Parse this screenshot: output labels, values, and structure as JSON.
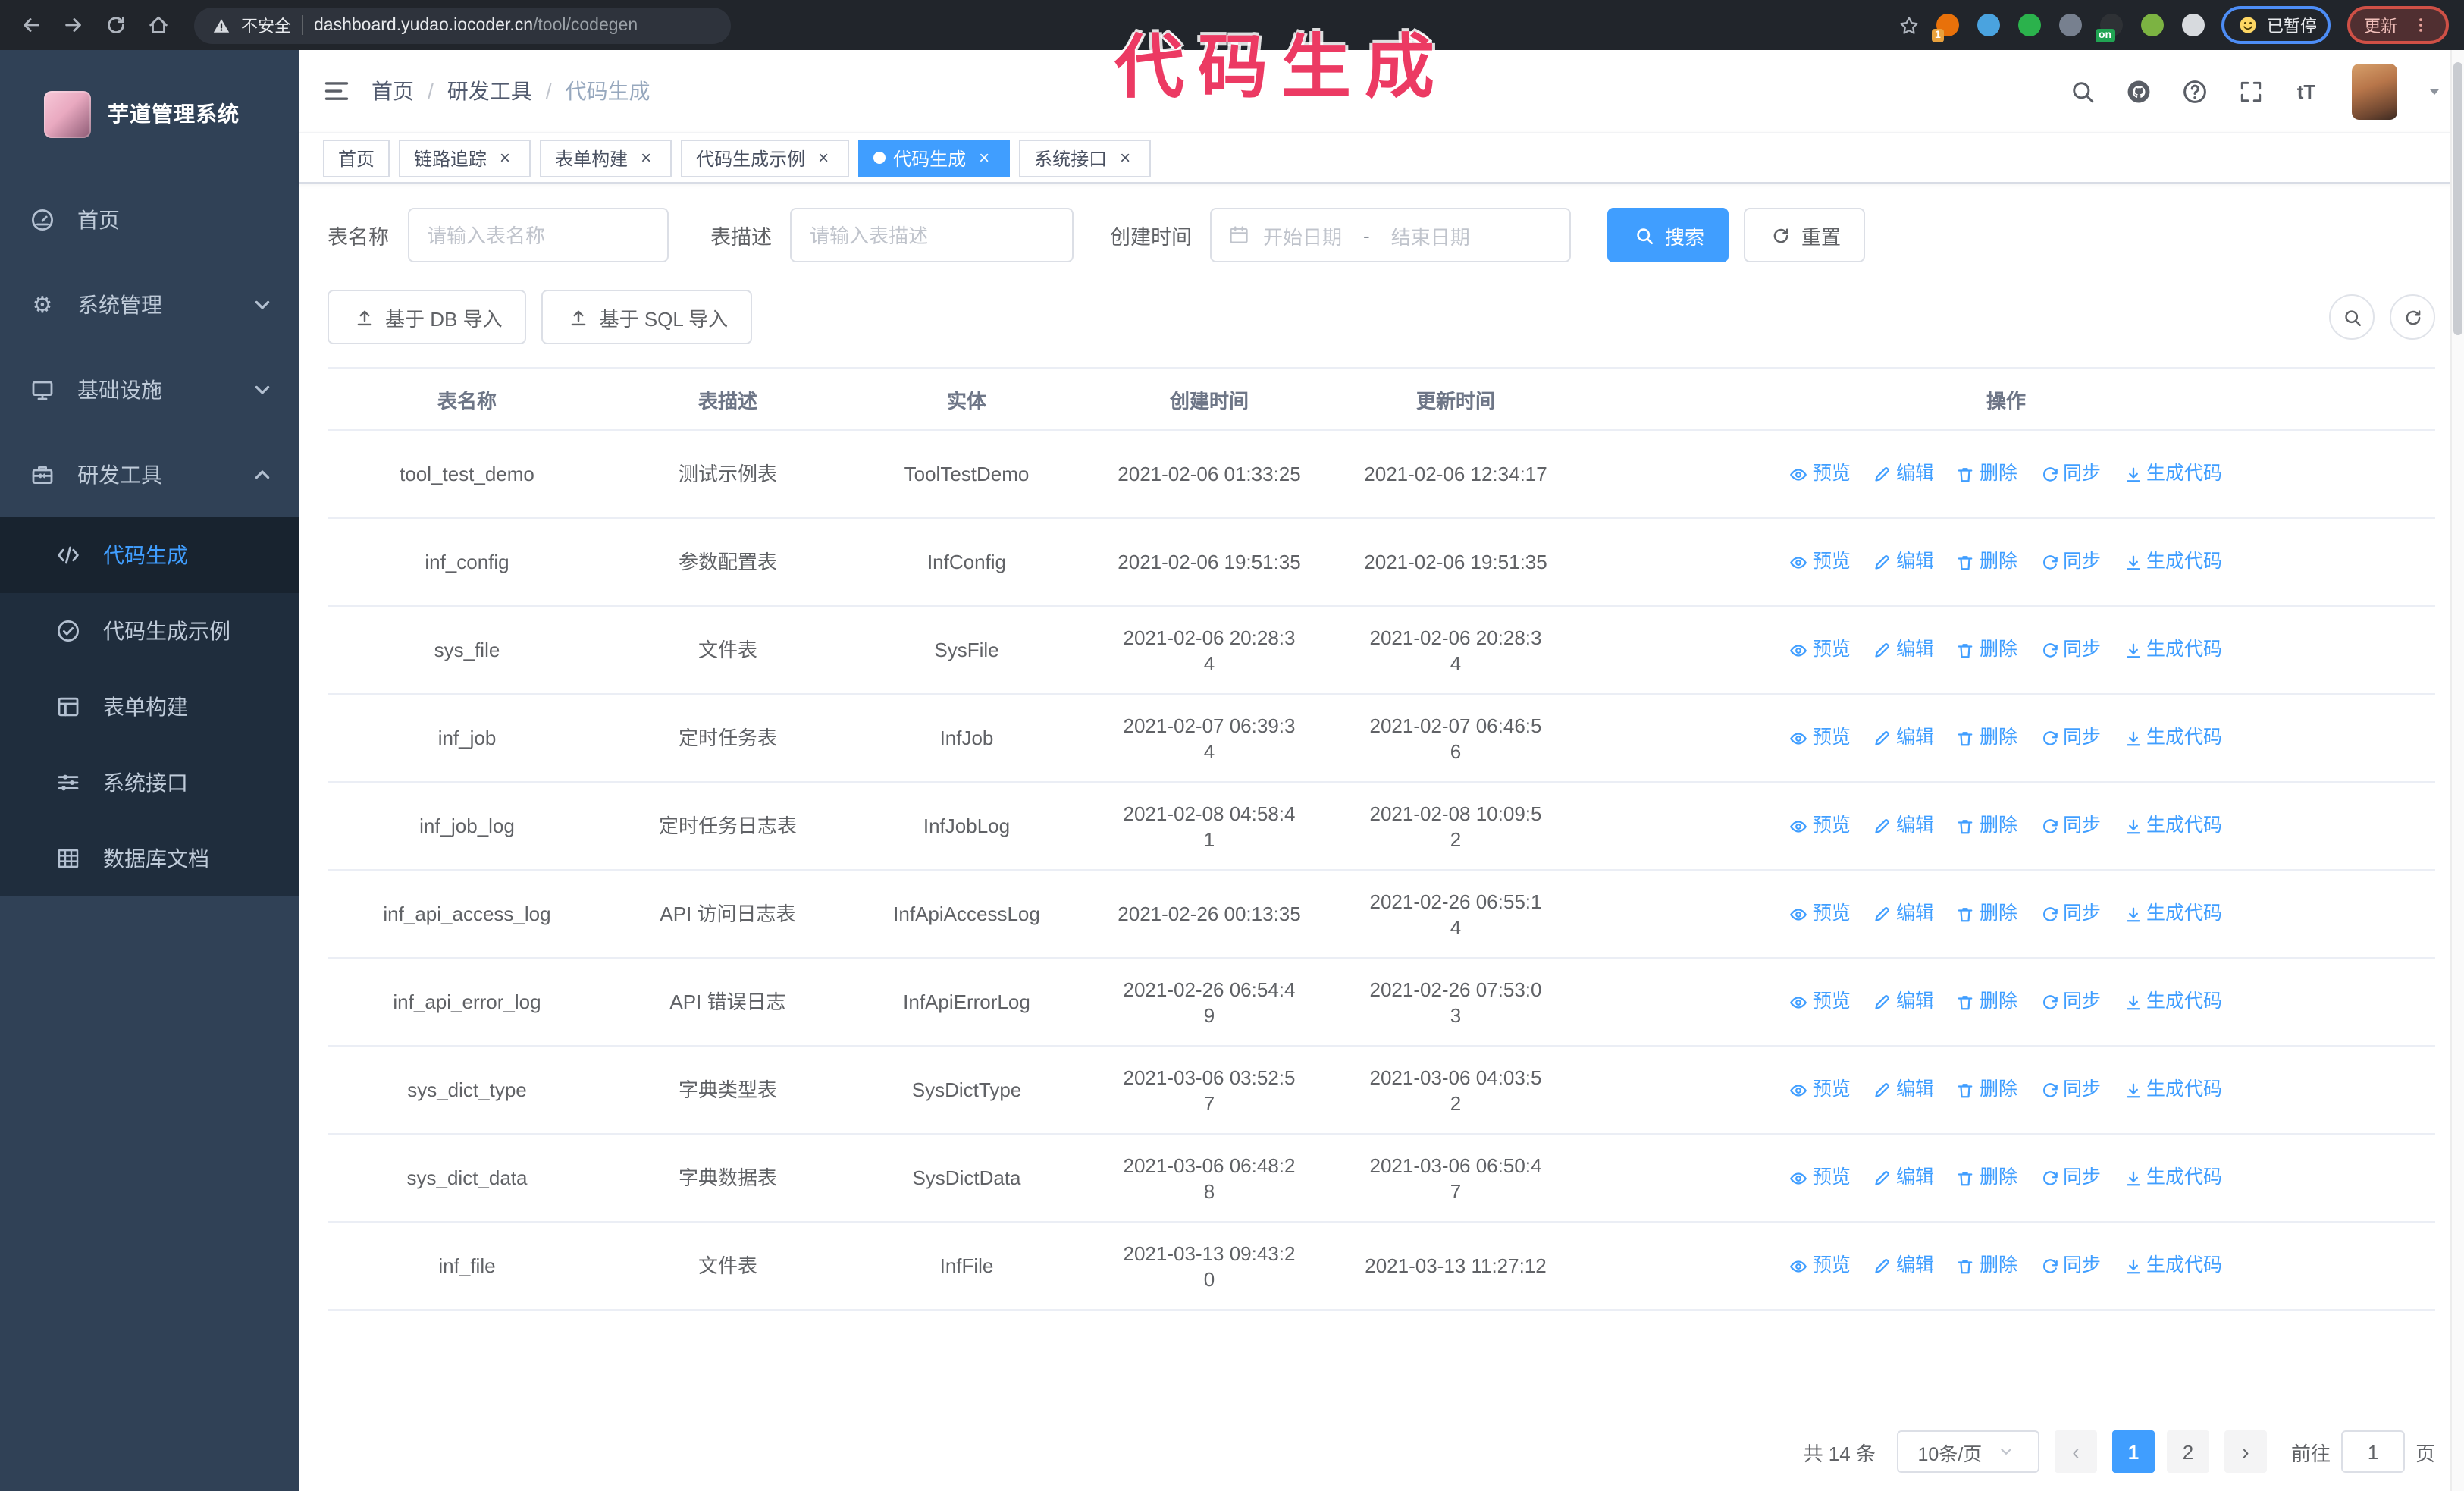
{
  "browser": {
    "security_label": "不安全",
    "url_host": "dashboard.yudao.iocoder.cn",
    "url_path": "/tool/codegen",
    "paused_badge": "已暂停",
    "update_button": "更新",
    "extensions": [
      {
        "key": "ext-orange",
        "name": "extension-orange-icon",
        "color": "#e8710a",
        "badge": "1",
        "badge_color": "#e8a13d"
      },
      {
        "key": "ext-blue",
        "name": "extension-blue-icon",
        "color": "#4aa3df"
      },
      {
        "key": "ext-green-check",
        "name": "extension-green-check-icon",
        "color": "#2bb24c"
      },
      {
        "key": "ext-gray",
        "name": "extension-gray-icon",
        "color": "#77808f"
      },
      {
        "key": "ext-dark",
        "name": "extension-dark-icon",
        "color": "#2e3135",
        "badge": "on",
        "badge_color": "#21a453"
      },
      {
        "key": "ext-lime",
        "name": "extension-lime-icon",
        "color": "#7cb342"
      },
      {
        "key": "ext-puzzle",
        "name": "extension-puzzle-icon",
        "color": "#d7dade"
      }
    ]
  },
  "annotation": {
    "text": "代码生成",
    "color": "#ec3a63"
  },
  "sidebar": {
    "title": "芋道管理系统",
    "items": [
      {
        "key": "home",
        "label": "首页",
        "icon": "gauge-icon",
        "expandable": false,
        "expanded": false
      },
      {
        "key": "system-management",
        "label": "系统管理",
        "icon": "gear-icon",
        "expandable": true,
        "expanded": false
      },
      {
        "key": "infrastructure",
        "label": "基础设施",
        "icon": "monitor-icon",
        "expandable": true,
        "expanded": false
      },
      {
        "key": "dev-tools",
        "label": "研发工具",
        "icon": "toolbox-icon",
        "expandable": true,
        "expanded": true
      }
    ],
    "submenu": [
      {
        "key": "codegen",
        "label": "代码生成",
        "icon": "code-icon",
        "active": true
      },
      {
        "key": "codegen-example",
        "label": "代码生成示例",
        "icon": "circle-check-icon",
        "active": false
      },
      {
        "key": "form-build",
        "label": "表单构建",
        "icon": "form-icon",
        "active": false
      },
      {
        "key": "system-api",
        "label": "系统接口",
        "icon": "sliders-icon",
        "active": false
      },
      {
        "key": "db-doc",
        "label": "数据库文档",
        "icon": "db-doc-icon",
        "active": false
      }
    ]
  },
  "header": {
    "breadcrumb": [
      "首页",
      "研发工具",
      "代码生成"
    ],
    "icons": [
      "search-icon",
      "github-icon",
      "question-icon",
      "fullscreen-icon",
      "font-size-icon"
    ]
  },
  "tabs": [
    {
      "key": "home",
      "label": "首页",
      "closable": false,
      "active": false
    },
    {
      "key": "trace",
      "label": "链路追踪",
      "closable": true,
      "active": false
    },
    {
      "key": "form-build",
      "label": "表单构建",
      "closable": true,
      "active": false
    },
    {
      "key": "codegen-example",
      "label": "代码生成示例",
      "closable": true,
      "active": false
    },
    {
      "key": "codegen",
      "label": "代码生成",
      "closable": true,
      "active": true
    },
    {
      "key": "system-api",
      "label": "系统接口",
      "closable": true,
      "active": false
    }
  ],
  "filters": {
    "name_label": "表名称",
    "name_placeholder": "请输入表名称",
    "desc_label": "表描述",
    "desc_placeholder": "请输入表描述",
    "time_label": "创建时间",
    "start_placeholder": "开始日期",
    "range_separator": "-",
    "end_placeholder": "结束日期",
    "search_label": "搜索",
    "reset_label": "重置"
  },
  "toolbar": {
    "import_db": "基于 DB 导入",
    "import_sql": "基于 SQL 导入"
  },
  "table": {
    "columns": [
      "表名称",
      "表描述",
      "实体",
      "创建时间",
      "更新时间",
      "操作"
    ],
    "actions": [
      {
        "key": "preview",
        "label": "预览",
        "icon": "eye-icon"
      },
      {
        "key": "edit",
        "label": "编辑",
        "icon": "edit-icon"
      },
      {
        "key": "delete",
        "label": "删除",
        "icon": "delete-icon"
      },
      {
        "key": "sync",
        "label": "同步",
        "icon": "sync-icon"
      },
      {
        "key": "generate-code",
        "label": "生成代码",
        "icon": "download-icon"
      }
    ],
    "rows": [
      {
        "name": "tool_test_demo",
        "desc": "测试示例表",
        "entity": "ToolTestDemo",
        "create": [
          "2021-02-06 01:33:25"
        ],
        "update": [
          "2021-02-06 12:34:17"
        ]
      },
      {
        "name": "inf_config",
        "desc": "参数配置表",
        "entity": "InfConfig",
        "create": [
          "2021-02-06 19:51:35"
        ],
        "update": [
          "2021-02-06 19:51:35"
        ]
      },
      {
        "name": "sys_file",
        "desc": "文件表",
        "entity": "SysFile",
        "create": [
          "2021-02-06 20:28:3",
          "4"
        ],
        "update": [
          "2021-02-06 20:28:3",
          "4"
        ]
      },
      {
        "name": "inf_job",
        "desc": "定时任务表",
        "entity": "InfJob",
        "create": [
          "2021-02-07 06:39:3",
          "4"
        ],
        "update": [
          "2021-02-07 06:46:5",
          "6"
        ]
      },
      {
        "name": "inf_job_log",
        "desc": "定时任务日志表",
        "entity": "InfJobLog",
        "create": [
          "2021-02-08 04:58:4",
          "1"
        ],
        "update": [
          "2021-02-08 10:09:5",
          "2"
        ]
      },
      {
        "name": "inf_api_access_log",
        "desc": "API 访问日志表",
        "entity": "InfApiAccessLog",
        "create": [
          "2021-02-26 00:13:35"
        ],
        "update": [
          "2021-02-26 06:55:1",
          "4"
        ]
      },
      {
        "name": "inf_api_error_log",
        "desc": "API 错误日志",
        "entity": "InfApiErrorLog",
        "create": [
          "2021-02-26 06:54:4",
          "9"
        ],
        "update": [
          "2021-02-26 07:53:0",
          "3"
        ]
      },
      {
        "name": "sys_dict_type",
        "desc": "字典类型表",
        "entity": "SysDictType",
        "create": [
          "2021-03-06 03:52:5",
          "7"
        ],
        "update": [
          "2021-03-06 04:03:5",
          "2"
        ]
      },
      {
        "name": "sys_dict_data",
        "desc": "字典数据表",
        "entity": "SysDictData",
        "create": [
          "2021-03-06 06:48:2",
          "8"
        ],
        "update": [
          "2021-03-06 06:50:4",
          "7"
        ]
      },
      {
        "name": "inf_file",
        "desc": "文件表",
        "entity": "InfFile",
        "create": [
          "2021-03-13 09:43:2",
          "0"
        ],
        "update": [
          "2021-03-13 11:27:12"
        ]
      }
    ]
  },
  "pagination": {
    "total": "共 14 条",
    "page_size": "10条/页",
    "pages": [
      "1",
      "2"
    ],
    "active_page": "1",
    "prev_label": "‹",
    "next_label": "›",
    "goto_label": "前往",
    "goto_value": "1",
    "page_label": "页"
  },
  "colors": {
    "primary": "#409eff",
    "sidebar_bg": "#304156",
    "submenu_bg": "#1f2d3d",
    "annotation": "#ec3a63"
  }
}
